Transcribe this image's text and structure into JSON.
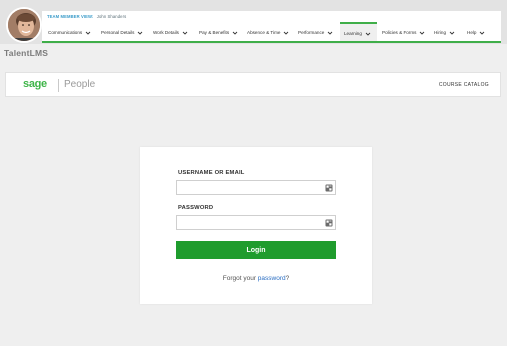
{
  "header": {
    "member_label": "TEAM MEMBER VIEW:",
    "member_name": "John Shanders",
    "nav": [
      {
        "label": "Communications",
        "active": false
      },
      {
        "label": "Personal Details",
        "active": false
      },
      {
        "label": "Work Details",
        "active": false
      },
      {
        "label": "Pay & Benefits",
        "active": false
      },
      {
        "label": "Absence & Time",
        "active": false
      },
      {
        "label": "Performance",
        "active": false
      },
      {
        "label": "Learning",
        "active": true
      },
      {
        "label": "Policies & Forms",
        "active": false
      },
      {
        "label": "Hiring",
        "active": false
      },
      {
        "label": "Help",
        "active": false
      }
    ]
  },
  "site_title": "TalentLMS",
  "brand": {
    "logo": "sage",
    "product": "People",
    "catalog_link": "COURSE CATALOG"
  },
  "login": {
    "username_label": "USERNAME OR EMAIL",
    "username_value": "",
    "password_label": "PASSWORD",
    "password_value": "",
    "submit_label": "Login",
    "forgot_prefix": "Forgot your ",
    "forgot_link": "password",
    "forgot_suffix": "?"
  },
  "colors": {
    "accent_green": "#3fae49",
    "button_green": "#1f9c2d",
    "link_blue": "#2b6ec3",
    "member_blue": "#3a9bc9",
    "page_bg": "#efefef"
  },
  "icons": [
    "chevron-down-icon",
    "password-manager-key-icon"
  ]
}
